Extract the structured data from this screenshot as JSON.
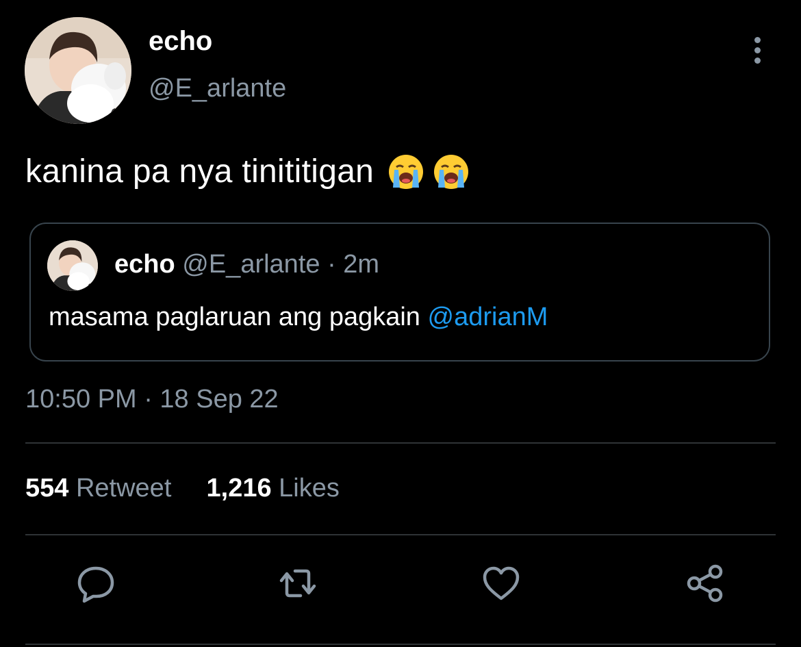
{
  "tweet": {
    "author_name": "echo",
    "author_handle": "@E_arlante",
    "text": "kanina pa nya tinititigan",
    "emojis": [
      "loudly-crying-face",
      "loudly-crying-face"
    ],
    "timestamp": "10:50 PM · 18 Sep 22"
  },
  "quoted": {
    "author_name": "echo",
    "author_handle": "@E_arlante",
    "separator": "·",
    "age": "2m",
    "text": "masama paglaruan ang pagkain",
    "mention": "@adrianM"
  },
  "stats": {
    "retweets_count": "554",
    "retweets_label": "Retweet",
    "likes_count": "1,216",
    "likes_label": "Likes"
  },
  "actions": [
    "reply-icon",
    "retweet-icon",
    "like-icon",
    "share-icon"
  ],
  "colors": {
    "background": "#000000",
    "secondary_text": "#8b98a5",
    "link": "#1d9bf0",
    "border": "#38444d"
  }
}
